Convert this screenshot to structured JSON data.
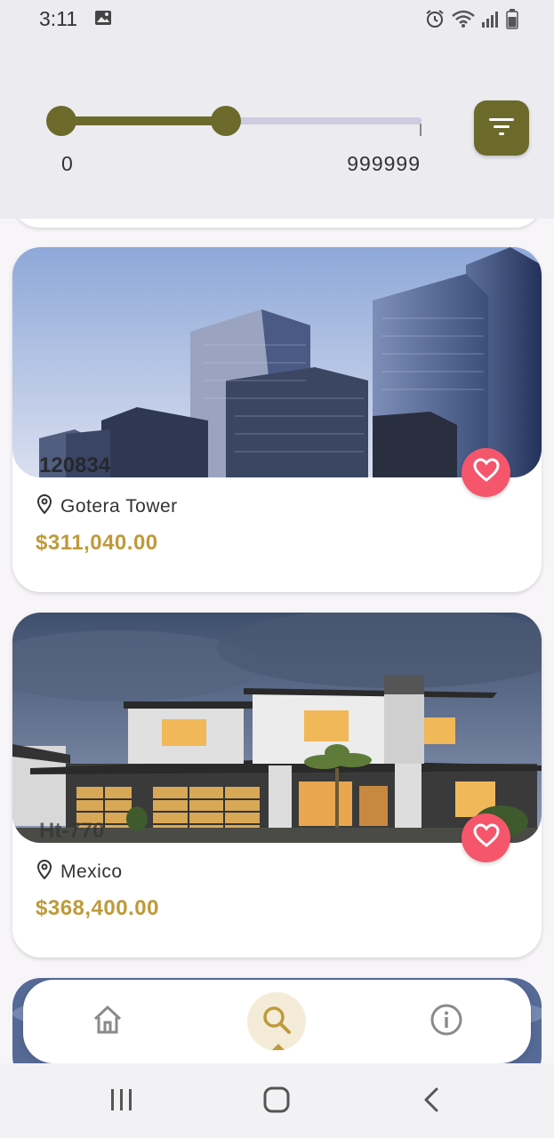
{
  "status_bar": {
    "time": "3:11",
    "icons": [
      "image-icon",
      "alarm-icon",
      "wifi-icon",
      "signal-icon",
      "battery-icon"
    ]
  },
  "price_filter": {
    "min_label": "0",
    "max_label": "999999",
    "range_min_fraction": 0.0,
    "range_max_fraction": 0.46,
    "accent_color": "#6b6a2b",
    "filter_button_icon": "filter-icon"
  },
  "properties": [
    {
      "code": "120834",
      "location": "Gotera Tower",
      "price": "$311,040.00",
      "favorite_icon": "heart-icon"
    },
    {
      "code": "Ht-770",
      "location": "Mexico",
      "price": "$368,400.00",
      "favorite_icon": "heart-icon"
    }
  ],
  "colors": {
    "price": "#bf9a3a",
    "favorite": "#f5566b",
    "active_nav_bg": "#f4ecd9"
  },
  "bottom_nav": {
    "items": [
      {
        "icon": "home-icon",
        "active": false
      },
      {
        "icon": "search-icon",
        "active": true
      },
      {
        "icon": "info-icon",
        "active": false
      }
    ]
  },
  "system_nav": {
    "icons": [
      "recents-icon",
      "home-circle-icon",
      "back-icon"
    ]
  }
}
